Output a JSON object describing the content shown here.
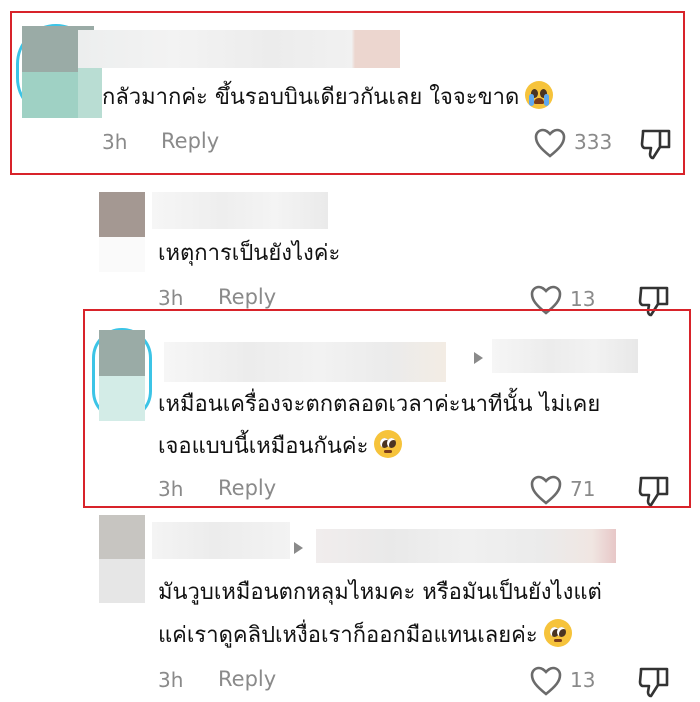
{
  "comments": [
    {
      "text": "กลัวมากค่ะ ขึ้นรอบบินเดียวกันเลย ใจจะขาด",
      "emoji": "loudly-crying-face",
      "time": "3h",
      "reply_label": "Reply",
      "likes": "333"
    },
    {
      "text": "เหตุการเป็นยังไงค่ะ",
      "time": "3h",
      "reply_label": "Reply",
      "likes": "13"
    },
    {
      "text_line1": "เหมือนเครื่องจะตกตลอดเวลาค่ะนาทีนั้น ไม่เคย",
      "text_line2": "เจอแบบนี้เหมือนกันค่ะ",
      "emoji": "pleading-face",
      "time": "3h",
      "reply_label": "Reply",
      "likes": "71"
    },
    {
      "text_line1": "มันวูบเหมือนตกหลุมไหมคะ หรือมันเป็นยังไงแต่",
      "text_line2": "แค่เราดูคลิปเหงื่อเราก็ออกมือแทนเลยค่ะ",
      "emoji": "pleading-face",
      "time": "3h",
      "reply_label": "Reply",
      "likes": "13"
    }
  ],
  "colors": {
    "highlight_border": "#d8232a",
    "meta_text": "#8a8a8a",
    "avatar_ring": "#3cc4e6"
  }
}
